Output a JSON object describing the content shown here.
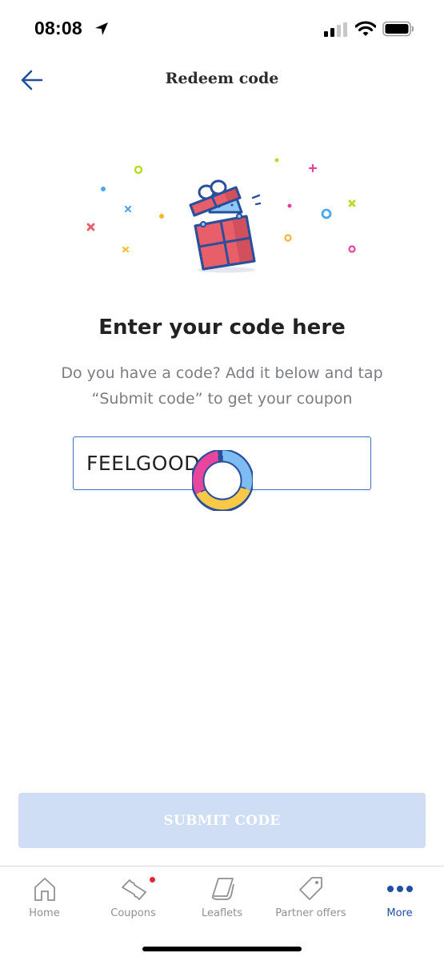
{
  "status_bar": {
    "time": "08:08",
    "location_icon": "location-arrow-icon",
    "signal_icon": "cellular-signal-icon",
    "wifi_icon": "wifi-icon",
    "battery_icon": "battery-icon"
  },
  "nav": {
    "title": "Redeem code",
    "back_icon": "arrow-left-icon"
  },
  "illustration": {
    "icon": "gift-box-icon"
  },
  "content": {
    "heading": "Enter your code here",
    "subtext": "Do you have a code? Add it below and tap “Submit code” to get your coupon"
  },
  "code_input": {
    "value": "FEELGOOD",
    "loading": true
  },
  "submit": {
    "label": "SUBMIT CODE",
    "enabled": false
  },
  "tabs": [
    {
      "label": "Home",
      "icon": "home-icon",
      "active": false
    },
    {
      "label": "Coupons",
      "icon": "ticket-icon",
      "active": false,
      "badge": true
    },
    {
      "label": "Leaflets",
      "icon": "leaflet-icon",
      "active": false
    },
    {
      "label": "Partner offers",
      "icon": "tag-icon",
      "active": false
    },
    {
      "label": "More",
      "icon": "more-dots-icon",
      "active": true
    }
  ],
  "colors": {
    "brand_blue": "#1f4fa3",
    "input_border": "#3d6fc4",
    "submit_disabled_bg": "#cfdef4",
    "badge_red": "#e0262e",
    "gift_red": "#e95f69"
  }
}
